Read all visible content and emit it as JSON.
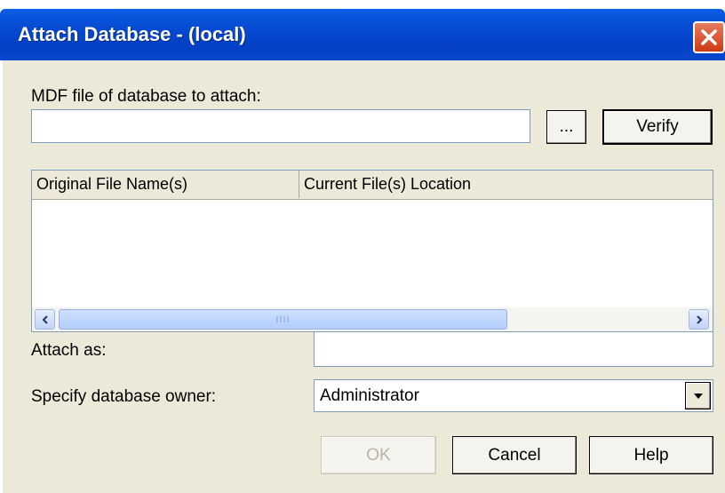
{
  "window": {
    "title": "Attach Database - (local)"
  },
  "mdf": {
    "label": "MDF file of database to attach:",
    "value": "",
    "browse_label": "...",
    "verify_label": "Verify"
  },
  "files_list": {
    "columns": [
      "Original File Name(s)",
      "Current File(s) Location"
    ],
    "rows": [],
    "scroll_left_icon": "<",
    "scroll_right_icon": ">",
    "scroll_grip": "IIII"
  },
  "attach_as": {
    "label": "Attach as:",
    "value": ""
  },
  "owner": {
    "label": "Specify database owner:",
    "selected": "Administrator"
  },
  "buttons": {
    "ok": "OK",
    "cancel": "Cancel",
    "help": "Help"
  },
  "icons": {
    "close": "close-icon",
    "dropdown": "chevron-down-icon"
  },
  "colors": {
    "titlebar": "#0548cf",
    "client": "#ece9d8",
    "close": "#cf3a14"
  }
}
